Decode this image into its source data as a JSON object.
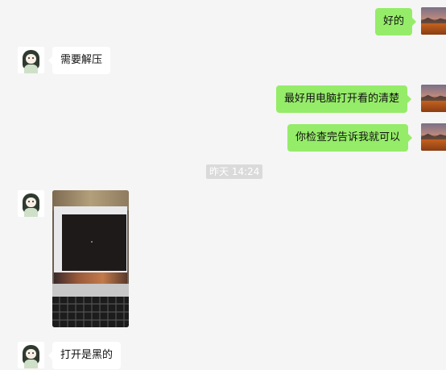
{
  "messages": [
    {
      "side": "right",
      "text": "好的"
    },
    {
      "side": "left",
      "text": "需要解压"
    },
    {
      "side": "right",
      "text": "最好用电脑打开看的清楚"
    },
    {
      "side": "right",
      "text": "你检查完告诉我就可以"
    },
    {
      "side": "left",
      "image": "laptop-photo"
    },
    {
      "side": "left",
      "text": "打开是黑的"
    }
  ],
  "timestamp": "昨天 14:24",
  "colors": {
    "background": "#f5f5f5",
    "sent_bubble": "#95ec69",
    "received_bubble": "#ffffff",
    "timestamp_bg": "#dadada"
  }
}
